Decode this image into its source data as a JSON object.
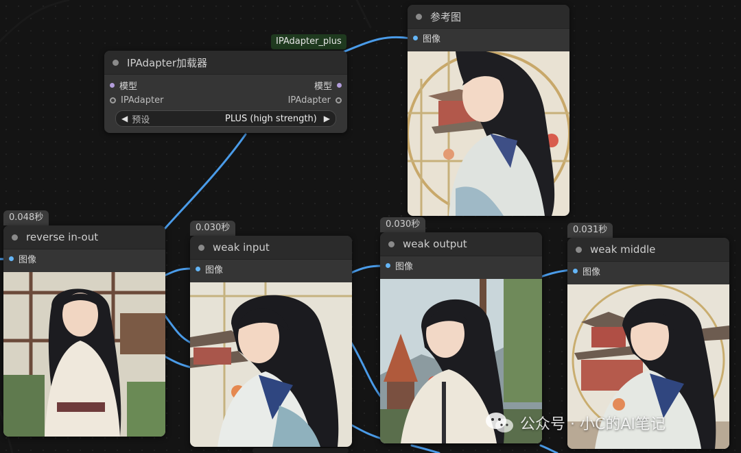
{
  "loader_node": {
    "title": "IPAdapter加载器",
    "inputs": [
      "模型",
      "IPAdapter"
    ],
    "outputs": [
      "模型",
      "IPAdapter"
    ],
    "preset_label": "预设",
    "preset_value": "PLUS (high strength)",
    "tag": "IPAdapter_plus"
  },
  "ref_node": {
    "title": "参考图",
    "output": "图像"
  },
  "result_nodes": [
    {
      "time": "0.048秒",
      "title": "reverse in-out",
      "output": "图像"
    },
    {
      "time": "0.030秒",
      "title": "weak input",
      "output": "图像"
    },
    {
      "time": "0.030秒",
      "title": "weak output",
      "output": "图像"
    },
    {
      "time": "0.031秒",
      "title": "weak middle",
      "output": "图像"
    }
  ],
  "watermark": "公众号 · 小C的AI笔记",
  "colors": {
    "image_pin": "#64b5f6",
    "model_pin": "#b39ddb",
    "wire": "#4a9be8"
  }
}
